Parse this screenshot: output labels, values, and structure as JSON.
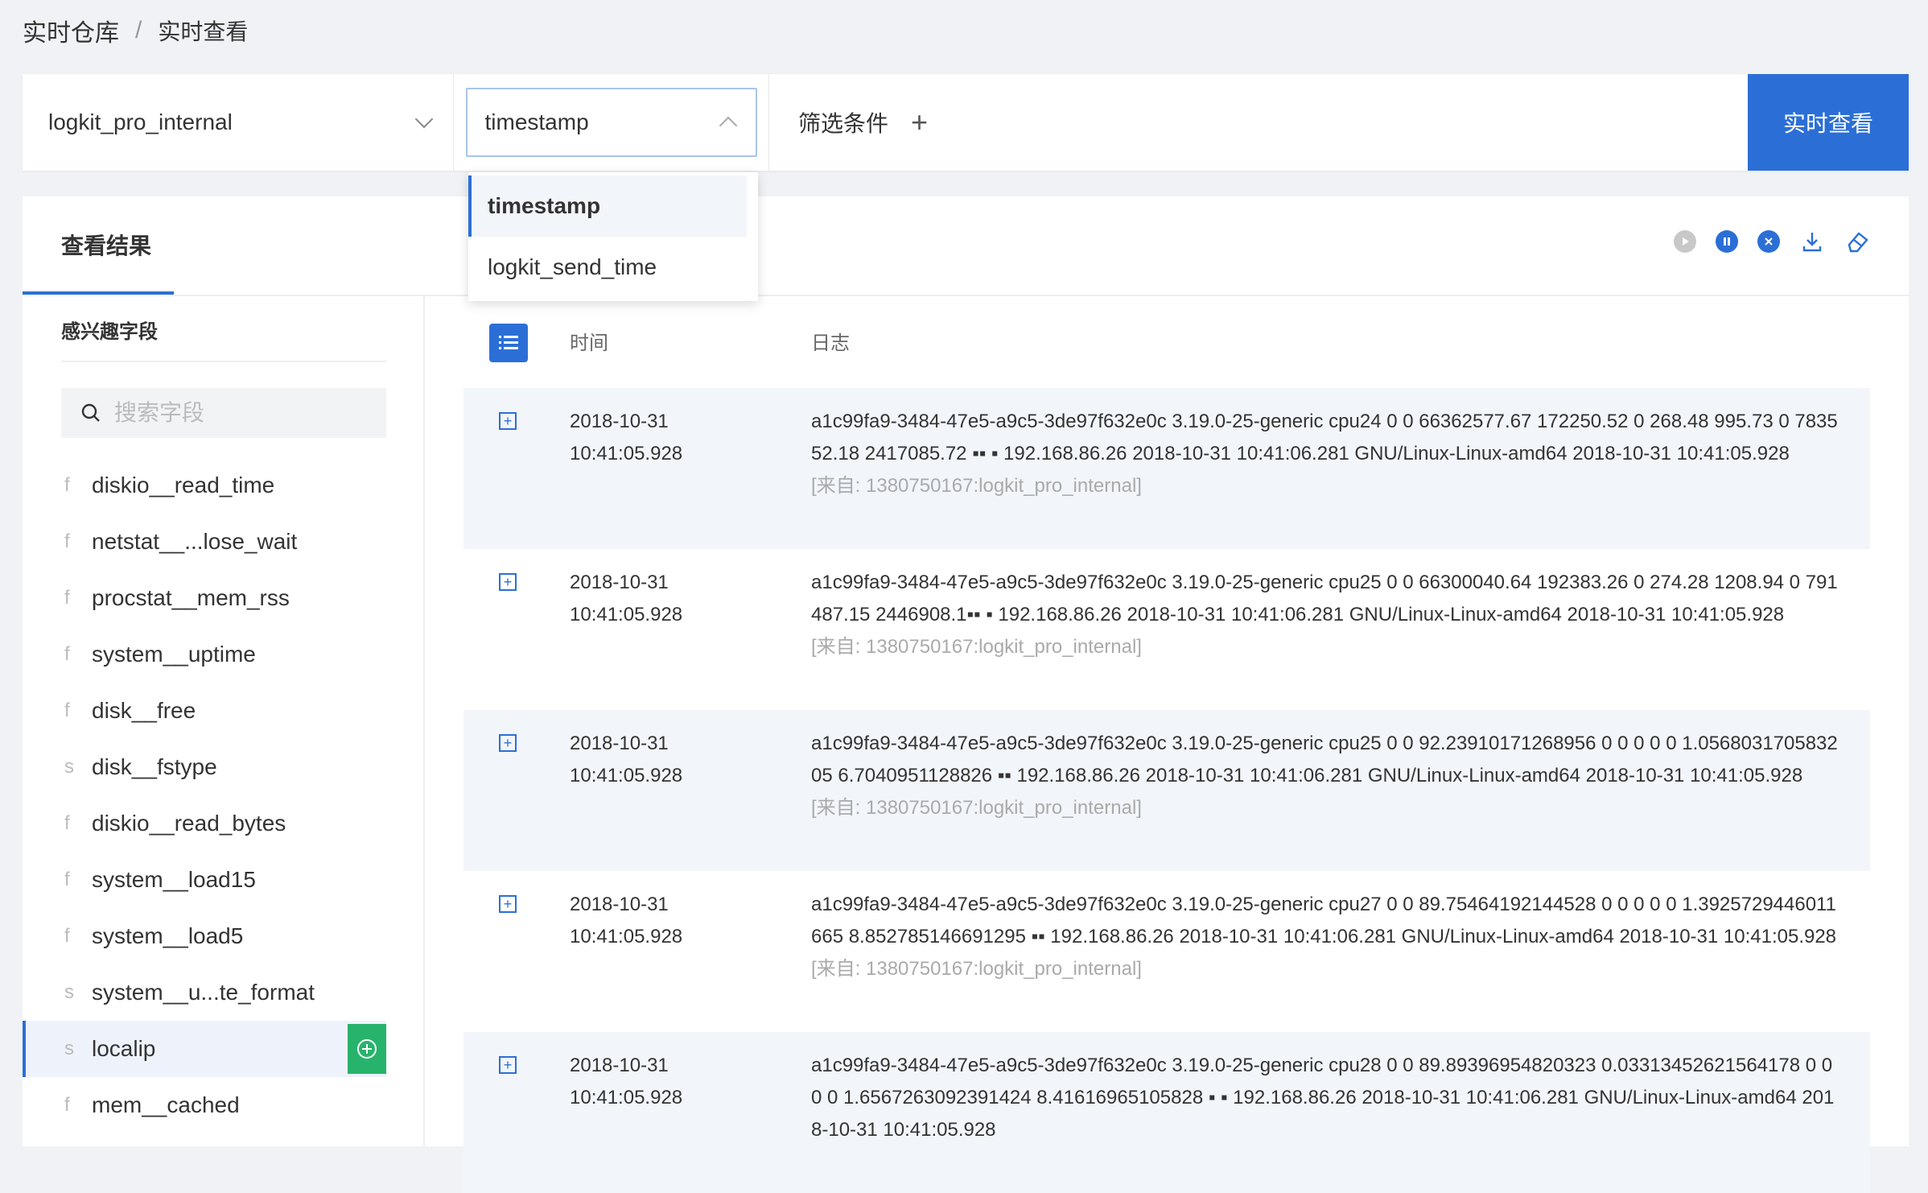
{
  "breadcrumb": {
    "root": "实时仓库",
    "separator": "/",
    "current": "实时查看"
  },
  "toolbar": {
    "repo": "logkit_pro_internal",
    "time_field": "timestamp",
    "filter_label": "筛选条件",
    "realtime_button": "实时查看"
  },
  "dropdown": {
    "options": [
      "timestamp",
      "logkit_send_time"
    ],
    "selected": "timestamp"
  },
  "panel": {
    "title": "查看结果"
  },
  "sidebar": {
    "title": "感兴趣字段",
    "search_placeholder": "搜索字段",
    "fields": [
      {
        "type": "f",
        "name": "diskio__read_time"
      },
      {
        "type": "f",
        "name": "netstat__...lose_wait"
      },
      {
        "type": "f",
        "name": "procstat__mem_rss"
      },
      {
        "type": "f",
        "name": "system__uptime"
      },
      {
        "type": "f",
        "name": "disk__free"
      },
      {
        "type": "s",
        "name": "disk__fstype"
      },
      {
        "type": "f",
        "name": "diskio__read_bytes"
      },
      {
        "type": "f",
        "name": "system__load15"
      },
      {
        "type": "f",
        "name": "system__load5"
      },
      {
        "type": "s",
        "name": "system__u...te_format"
      },
      {
        "type": "s",
        "name": "localip"
      },
      {
        "type": "f",
        "name": "mem__cached"
      }
    ]
  },
  "table": {
    "col_time": "时间",
    "col_log": "日志",
    "rows": [
      {
        "date": "2018-10-31",
        "time": "10:41:05.928",
        "log": "a1c99fa9-3484-47e5-a9c5-3de97f632e0c 3.19.0-25-generic cpu24 0 0 66362577.67 172250.52 0 268.48 995.73 0 783552.18 2417085.72 ▪▪ ▪ 192.168.86.26 2018-10-31 10:41:06.281 GNU/Linux-Linux-amd64 2018-10-31 10:41:05.928",
        "source": "[来自: 1380750167:logkit_pro_internal]"
      },
      {
        "date": "2018-10-31",
        "time": "10:41:05.928",
        "log": "a1c99fa9-3484-47e5-a9c5-3de97f632e0c 3.19.0-25-generic cpu25 0 0 66300040.64 192383.26 0 274.28 1208.94 0 791487.15 2446908.1▪▪ ▪ 192.168.86.26 2018-10-31 10:41:06.281 GNU/Linux-Linux-amd64 2018-10-31 10:41:05.928",
        "source": "[来自: 1380750167:logkit_pro_internal]"
      },
      {
        "date": "2018-10-31",
        "time": "10:41:05.928",
        "log": "a1c99fa9-3484-47e5-a9c5-3de97f632e0c 3.19.0-25-generic cpu25 0 0 92.23910171268956 0 0 0 0 0 1.056803170583205 6.7040951128826 ▪▪ 192.168.86.26 2018-10-31 10:41:06.281 GNU/Linux-Linux-amd64 2018-10-31 10:41:05.928",
        "source": "[来自: 1380750167:logkit_pro_internal]"
      },
      {
        "date": "2018-10-31",
        "time": "10:41:05.928",
        "log": "a1c99fa9-3484-47e5-a9c5-3de97f632e0c 3.19.0-25-generic cpu27 0 0 89.75464192144528 0 0 0 0 0 1.3925729446011665 8.852785146691295 ▪▪ 192.168.86.26 2018-10-31 10:41:06.281 GNU/Linux-Linux-amd64 2018-10-31 10:41:05.928",
        "source": "[来自: 1380750167:logkit_pro_internal]"
      },
      {
        "date": "2018-10-31",
        "time": "10:41:05.928",
        "log": "a1c99fa9-3484-47e5-a9c5-3de97f632e0c 3.19.0-25-generic cpu28 0 0 89.89396954820323 0.03313452621564178 0 0 0 0 1.6567263092391424 8.41616965105828 ▪ ▪ 192.168.86.26 2018-10-31 10:41:06.281 GNU/Linux-Linux-amd64 2018-10-31 10:41:05.928",
        "source": ""
      }
    ]
  }
}
